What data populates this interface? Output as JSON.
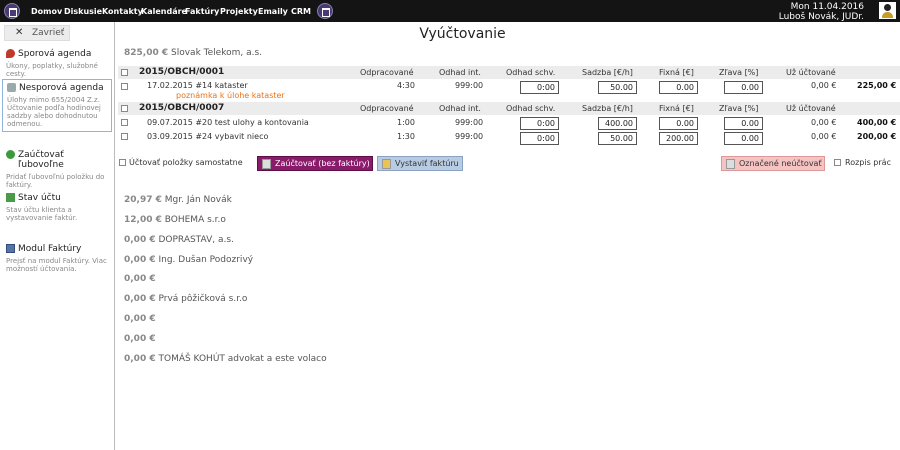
{
  "topbar": {
    "nav": [
      "Domov",
      "Diskusie",
      "Kontakty",
      "Kalendáre",
      "Faktúry",
      "Projekty",
      "Emaily",
      "CRM"
    ],
    "date": "Mon 11.04.2016",
    "user": "Luboš Novák, JUDr."
  },
  "sidebar": {
    "close_label": "Zavrieť",
    "items": [
      {
        "title": "Sporová agenda",
        "desc": "Úkony, poplatky, služobné cesty."
      },
      {
        "title": "Nesporová agenda",
        "desc": "Úlohy mimo 655/2004 Z.z. Účtovanie podľa hodinovej sadzby alebo dohodnutou odmenou."
      },
      {
        "title": "Zaúčtovať ľubovoľne",
        "desc": "Pridať ľubovoľnú položku do faktúry."
      },
      {
        "title": "Stav účtu",
        "desc": "Stav účtu klienta a vystavovanie faktúr."
      },
      {
        "title": "Modul Faktúry",
        "desc": "Prejsť na modul Faktúry. Viac možností účtovania."
      }
    ]
  },
  "main": {
    "title": "Vyúčtovanie",
    "company_amount": "825,00 €",
    "company_name": "Slovak Telekom, a.s.",
    "columns": [
      "Odpracované",
      "Odhad int.",
      "Odhad schv.",
      "Sadzba [€/h]",
      "Fixná [€]",
      "Zľava [%]",
      "Už účtované"
    ],
    "groups": [
      {
        "case_no": "2015/OBCH/0001",
        "rows": [
          {
            "date_desc": "17.02.2015 #14 kataster",
            "note": "poznámka k úlohe kataster",
            "worked": "4:30",
            "estimate": "999:00",
            "approved": "0:00",
            "rate": "50.00",
            "fixed": "0.00",
            "discount": "0.00",
            "billed": "0,00 €",
            "total": "225,00 €"
          }
        ]
      },
      {
        "case_no": "2015/OBCH/0007",
        "rows": [
          {
            "date_desc": "09.07.2015 #20 test ulohy a kontovania",
            "worked": "1:00",
            "estimate": "999:00",
            "approved": "0:00",
            "rate": "400.00",
            "fixed": "0.00",
            "discount": "0.00",
            "billed": "0,00 €",
            "total": "400,00 €"
          },
          {
            "date_desc": "03.09.2015 #24 vybavit nieco",
            "worked": "1:30",
            "estimate": "999:00",
            "approved": "0:00",
            "rate": "50.00",
            "fixed": "200.00",
            "discount": "0.00",
            "billed": "0,00 €",
            "total": "200,00 €"
          }
        ]
      }
    ],
    "actions": {
      "separate_label": "Účtovať položky samostatne",
      "post_label": "Zaúčtovať (bez faktúry)",
      "invoice_label": "Vystaviť faktúru",
      "unbill_label": "Označené neúčtovať",
      "breakdown_label": "Rozpis prác"
    },
    "summary": [
      {
        "amount": "20,97 €",
        "name": "Mgr. Ján Novák"
      },
      {
        "amount": "12,00 €",
        "name": "BOHEMA s.r.o"
      },
      {
        "amount": "0,00 €",
        "name": "DOPRASTAV, a.s."
      },
      {
        "amount": "0,00 €",
        "name": "Ing. Dušan Podozrivý"
      },
      {
        "amount": "0,00 €",
        "name": ""
      },
      {
        "amount": "0,00 €",
        "name": "Prvá pôžičková s.r.o"
      },
      {
        "amount": "0,00 €",
        "name": ""
      },
      {
        "amount": "0,00 €",
        "name": ""
      },
      {
        "amount": "0,00 €",
        "name": "TOMÁŠ KOHÚT advokat a este volaco"
      }
    ]
  }
}
